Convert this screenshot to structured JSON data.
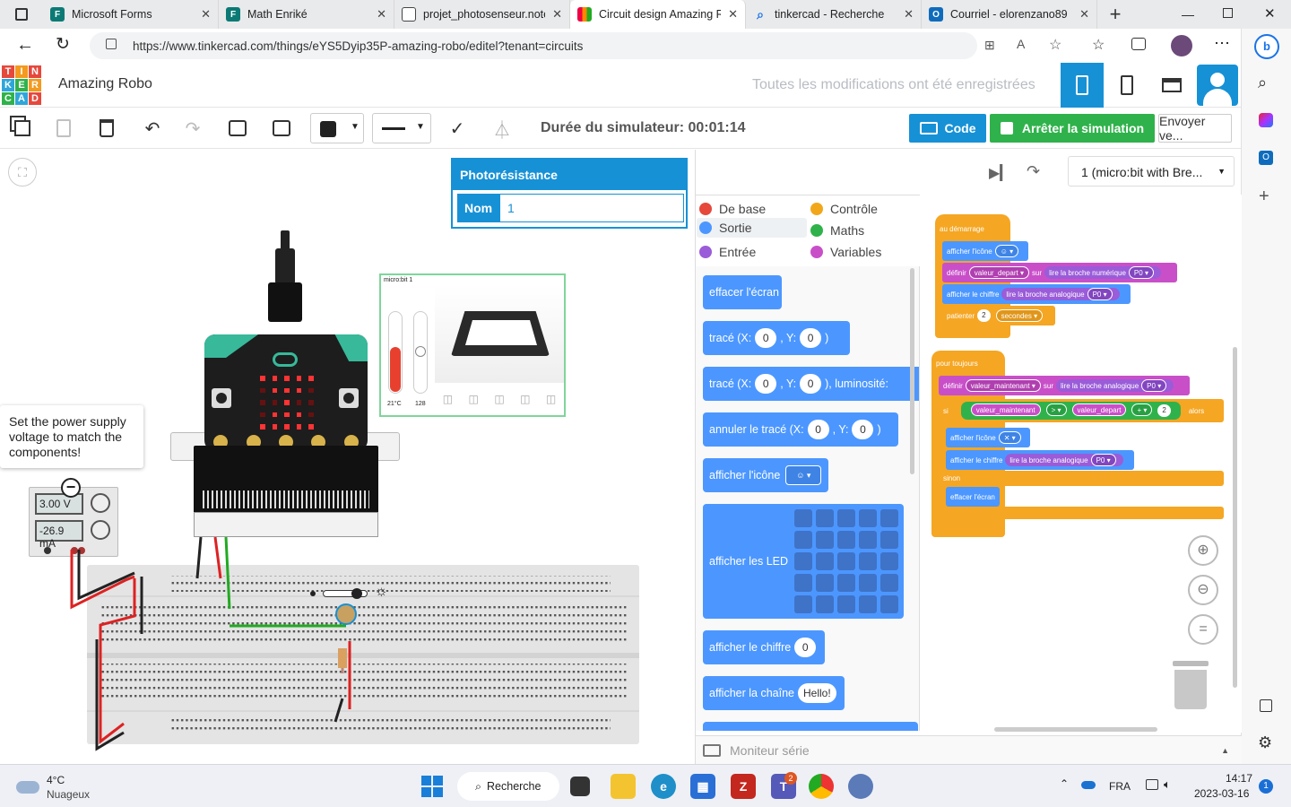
{
  "browser": {
    "tabs": [
      {
        "title": "Microsoft Forms",
        "icon": "forms-icon",
        "color": "#0b7a75"
      },
      {
        "title": "Math Enriké",
        "icon": "forms-icon",
        "color": "#0b7a75"
      },
      {
        "title": "projet_photosenseur.note",
        "icon": "document-icon",
        "color": "#ffffff"
      },
      {
        "title": "Circuit design Amazing R",
        "icon": "tinkercad-icon",
        "color": "#ffffff"
      },
      {
        "title": "tinkercad - Recherche",
        "icon": "search-icon",
        "color": "#ffffff"
      },
      {
        "title": "Courriel - elorenzano89",
        "icon": "outlook-icon",
        "color": "#0f6cbd"
      }
    ],
    "url": "https://www.tinkercad.com/things/eYS5Dyip35P-amazing-robo/editel?tenant=circuits"
  },
  "app": {
    "title": "Amazing Robo",
    "saved_status": "Toutes les modifications ont été enregistrées",
    "logo_letters": [
      "T",
      "I",
      "N",
      "K",
      "E",
      "R",
      "C",
      "A",
      "D"
    ]
  },
  "toolbar": {
    "sim_time": "Durée du simulateur: 00:01:14",
    "code_label": "Code",
    "stop_label": "Arrêter la simulation",
    "send_label": "Envoyer ve..."
  },
  "inspector": {
    "title": "Photorésistance",
    "name_label": "Nom",
    "name_value": "1"
  },
  "tooltip": "Set the power supply voltage to match the components!",
  "power_supply": {
    "voltage": "3.00 V",
    "current": "-26.9 mA"
  },
  "microbit_panel": {
    "title": "micro:bit 1",
    "temp": "21°C",
    "light": "128"
  },
  "code": {
    "device_select": "1 (micro:bit with Bre...",
    "categories": [
      {
        "label": "De base",
        "color": "#e6483c"
      },
      {
        "label": "Contrôle",
        "color": "#f2a71b"
      },
      {
        "label": "Sortie",
        "color": "#4c97ff"
      },
      {
        "label": "Maths",
        "color": "#2fb24b"
      },
      {
        "label": "Entrée",
        "color": "#9a5cd8"
      },
      {
        "label": "Variables",
        "color": "#c94fc9"
      }
    ],
    "palette": {
      "clear": "effacer l'écran",
      "plot": "tracé (X:",
      "plot_y": ", Y:",
      "plot_brightness": "), luminosité:",
      "unplot": "annuler le tracé (X:",
      "show_icon": "afficher l'icône",
      "show_leds": "afficher les LED",
      "show_number": "afficher le chiffre",
      "show_number_value": "0",
      "show_string": "afficher la chaîne",
      "show_string_value": "Hello!",
      "zero": "0",
      "paren": ")"
    },
    "script": {
      "on_start": "au démarrage",
      "show_icon": "afficher l'icône",
      "set": "définir",
      "var_depart": "valeur_depart",
      "on": "sur",
      "read_digital": "lire la broche numérique",
      "pin": "P0",
      "show_number": "afficher le chiffre",
      "read_analog": "lire la broche analogique",
      "pause": "patienter",
      "pause_value": "2",
      "seconds": "secondes",
      "forever": "pour toujours",
      "var_now": "valeur_maintenant",
      "if": "si",
      "gt": ">",
      "plus": "+",
      "plus_value": "2",
      "then": "alors",
      "else": "sinon",
      "clear": "effacer l'écran"
    },
    "serial_monitor": "Moniteur série"
  },
  "taskbar": {
    "weather_temp": "4°C",
    "weather_desc": "Nuageux",
    "search": "Recherche",
    "lang": "FRA",
    "time": "14:17",
    "date": "2023-03-16",
    "notif_count": "1",
    "teams_badge": "2"
  }
}
